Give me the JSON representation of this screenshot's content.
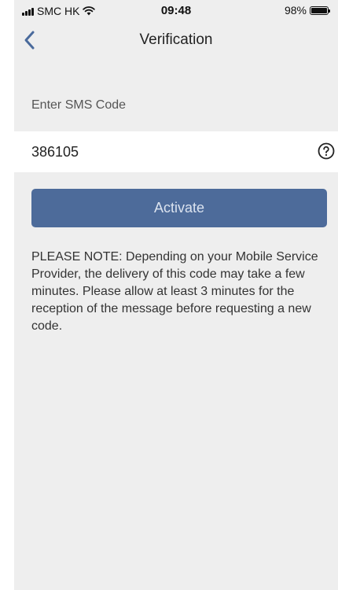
{
  "status_bar": {
    "carrier": "SMC HK",
    "time": "09:48",
    "battery": "98%",
    "battery_level": 0.98
  },
  "nav": {
    "title": "Verification",
    "back_icon": "chevron-left-icon"
  },
  "form": {
    "label": "Enter SMS Code",
    "code_value": "386105",
    "help_icon": "question-circle-icon"
  },
  "activate_label": "Activate",
  "note": "PLEASE NOTE: Depending on your Mobile Service Provider, the delivery of this code may take a few minutes. Please allow at least 3 minutes for the reception of the message before requesting a new code.",
  "colors": {
    "accent": "#4d6b9a",
    "background": "#eeeeee",
    "back_icon": "#4a6a9c"
  }
}
